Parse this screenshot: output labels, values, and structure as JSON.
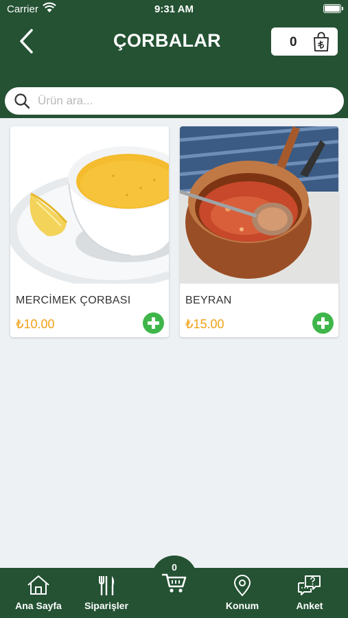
{
  "status_bar": {
    "carrier": "Carrier",
    "time": "9:31 AM"
  },
  "header": {
    "title": "ÇORBALAR",
    "cart_count": "0"
  },
  "search": {
    "placeholder": "Ürün ara..."
  },
  "products": [
    {
      "name": "MERCİMEK ÇORBASI",
      "price": "₺10.00"
    },
    {
      "name": "BEYRAN",
      "price": "₺15.00"
    }
  ],
  "tabs": [
    {
      "label": "Ana Sayfa",
      "icon": "home-icon"
    },
    {
      "label": "Siparişler",
      "icon": "cutlery-icon"
    },
    {
      "label": "Konum",
      "icon": "location-pin-icon"
    },
    {
      "label": "Anket",
      "icon": "survey-chat-icon"
    }
  ],
  "cart_fab": {
    "count": "0",
    "icon": "cart-icon"
  },
  "colors": {
    "brand_green": "#245233",
    "price_orange": "#f0a116",
    "add_green": "#3fb64a"
  }
}
